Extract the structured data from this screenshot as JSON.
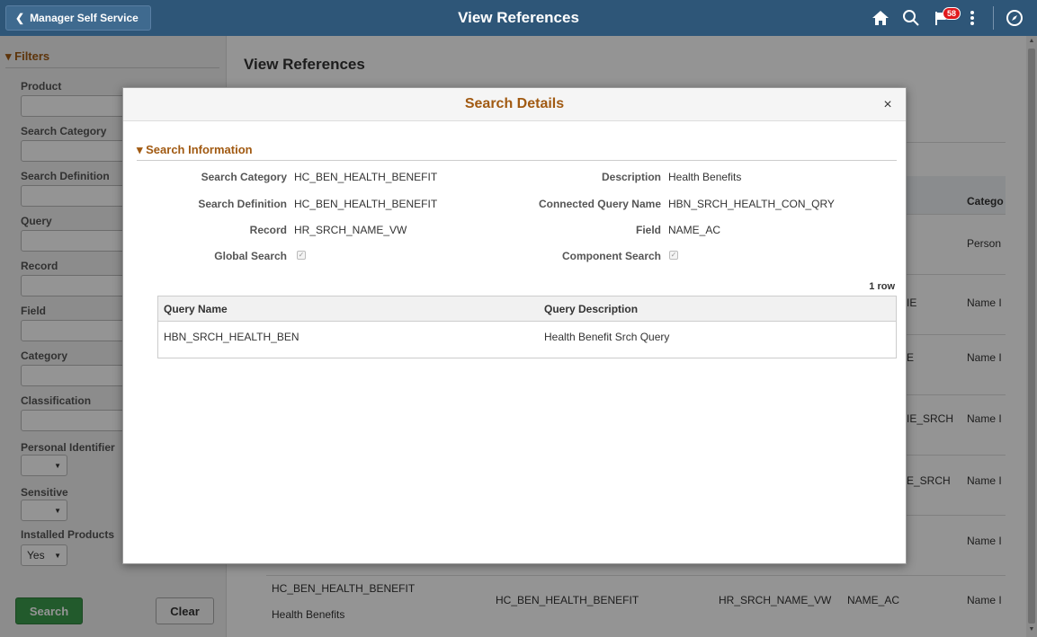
{
  "header": {
    "back_label": "Manager Self Service",
    "title": "View References",
    "notification_count": "58",
    "icons": [
      "chevron-left-icon",
      "home-icon",
      "search-icon",
      "flag-icon",
      "more-vertical-icon",
      "compass-icon"
    ]
  },
  "filters": {
    "heading": "Filters",
    "fields": {
      "product": "Product",
      "search_category": "Search Category",
      "search_definition": "Search Definition",
      "query": "Query",
      "record": "Record",
      "field": "Field",
      "category": "Category",
      "classification": "Classification",
      "personal_identifier": "Personal Identifier",
      "sensitive": "Sensitive",
      "installed_products": "Installed Products"
    },
    "installed_products_value": "Yes",
    "search_button": "Search",
    "clear_button": "Clear"
  },
  "main": {
    "title": "View References",
    "category_header": "Catego",
    "rows": [
      {
        "partial": "",
        "category": "Person"
      },
      {
        "partial": "IE",
        "category": "Name I"
      },
      {
        "partial": "E",
        "category": "Name I"
      },
      {
        "partial": "IE_SRCH",
        "category": "Name I"
      },
      {
        "partial": "E_SRCH",
        "category": "Name I"
      },
      {
        "partial": "",
        "category": "Name I"
      }
    ],
    "last_row": {
      "search_category": "HC_BEN_HEALTH_BENEFIT",
      "description": "Health Benefits",
      "search_definition": "HC_BEN_HEALTH_BENEFIT",
      "record": "HR_SRCH_NAME_VW",
      "field": "NAME_AC",
      "category": "Name I"
    }
  },
  "modal": {
    "title": "Search Details",
    "close": "×",
    "section": "Search Information",
    "labels": {
      "search_category": "Search Category",
      "search_definition": "Search Definition",
      "record": "Record",
      "global_search": "Global Search",
      "description": "Description",
      "connected_query_name": "Connected Query Name",
      "field": "Field",
      "component_search": "Component Search"
    },
    "values": {
      "search_category": "HC_BEN_HEALTH_BENEFIT",
      "search_definition": "HC_BEN_HEALTH_BENEFIT",
      "record": "HR_SRCH_NAME_VW",
      "description": "Health Benefits",
      "connected_query_name": "HBN_SRCH_HEALTH_CON_QRY",
      "field": "NAME_AC"
    },
    "row_count": "1 row",
    "table": {
      "headers": [
        "Query Name",
        "Query Description"
      ],
      "rows": [
        [
          "HBN_SRCH_HEALTH_BEN",
          "Health Benefit Srch Query"
        ]
      ]
    }
  }
}
